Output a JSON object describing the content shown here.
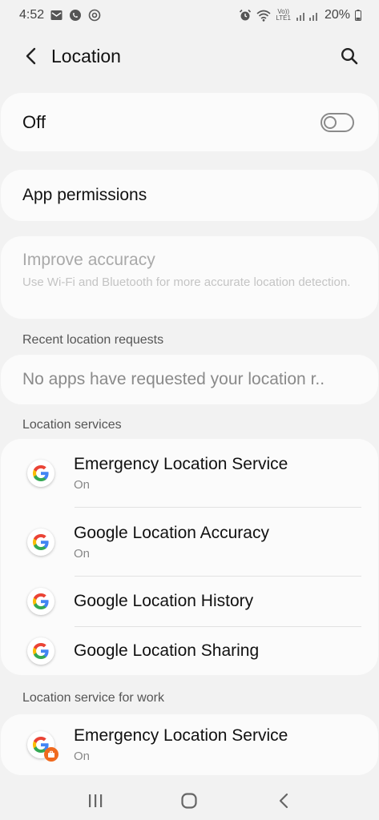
{
  "status_bar": {
    "time": "4:52",
    "battery": "20%",
    "left_icons": [
      "email-icon",
      "whatsapp-icon",
      "sync-icon"
    ],
    "right_icons": [
      "alarm-icon",
      "wifi-icon",
      "volte-icon",
      "signal-icon",
      "battery-icon"
    ],
    "volte_top": "Vo))",
    "volte_bottom": "LTE1"
  },
  "app_bar": {
    "title": "Location",
    "back_icon": "back-arrow-icon",
    "search_icon": "search-icon"
  },
  "master_switch": {
    "label": "Off",
    "state": "off"
  },
  "app_permissions": {
    "label": "App permissions"
  },
  "improve_accuracy": {
    "title": "Improve accuracy",
    "subtitle": "Use Wi-Fi and Bluetooth for more accurate location detection.",
    "disabled": true
  },
  "recent_requests": {
    "header": "Recent location requests",
    "empty_text": "No apps have requested your location r.."
  },
  "location_services": {
    "header": "Location services",
    "items": [
      {
        "title": "Emergency Location Service",
        "subtitle": "On"
      },
      {
        "title": "Google Location Accuracy",
        "subtitle": "On"
      },
      {
        "title": "Google Location History",
        "subtitle": ""
      },
      {
        "title": "Google Location Sharing",
        "subtitle": ""
      }
    ]
  },
  "work_services": {
    "header": "Location service for work",
    "items": [
      {
        "title": "Emergency Location Service",
        "subtitle": "On"
      }
    ]
  },
  "nav_bar": {
    "icons": [
      "recents-icon",
      "home-icon",
      "back-icon"
    ]
  },
  "colors": {
    "background": "#f2f2f2",
    "card": "#fbfbfb",
    "google_blue": "#4285f4",
    "google_red": "#ea4335",
    "google_yellow": "#fbbc05",
    "google_green": "#34a853",
    "work_badge": "#f06a1e"
  }
}
